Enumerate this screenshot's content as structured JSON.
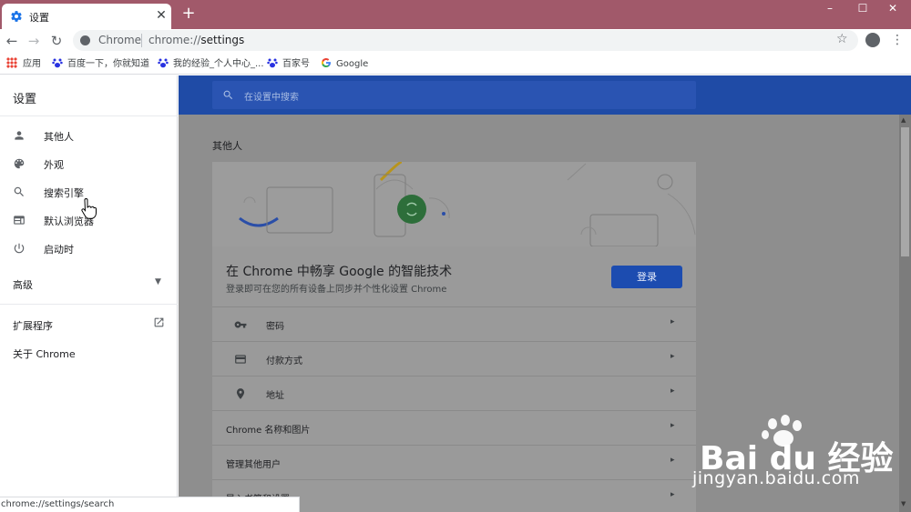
{
  "browser": {
    "tab_title": "设置",
    "tab_close": "✕",
    "new_tab": "+",
    "window_controls": [
      "–",
      "☐",
      "✕"
    ],
    "nav": {
      "back": "←",
      "forward": "→",
      "reload": "↻"
    },
    "omnibox": {
      "site_name": "Chrome",
      "url_scheme": "chrome://",
      "url_path": "settings"
    },
    "bookmarks": [
      {
        "label": "应用",
        "icon": "apps-grid-icon"
      },
      {
        "label": "百度一下，你就知道",
        "icon": "baidu-paw-icon"
      },
      {
        "label": "我的经验_个人中心_...",
        "icon": "baidu-paw-icon"
      },
      {
        "label": "百家号",
        "icon": "baidu-paw-icon"
      },
      {
        "label": "Google",
        "icon": "google-g-icon"
      }
    ],
    "status_text": "chrome://settings/search"
  },
  "sidebar": {
    "header": "设置",
    "items": [
      {
        "label": "其他人",
        "icon": "person-icon"
      },
      {
        "label": "外观",
        "icon": "palette-icon"
      },
      {
        "label": "搜索引擎",
        "icon": "search-icon"
      },
      {
        "label": "默认浏览器",
        "icon": "browser-window-icon"
      },
      {
        "label": "启动时",
        "icon": "power-icon"
      }
    ],
    "advanced": "高级",
    "extensions": "扩展程序",
    "about": "关于 Chrome"
  },
  "main": {
    "search_placeholder": "在设置中搜索",
    "section_title": "其他人",
    "signin_title": "在 Chrome 中畅享 Google 的智能技术",
    "signin_subtitle": "登录即可在您的所有设备上同步并个性化设置 Chrome",
    "login_button": "登录",
    "rows": [
      {
        "label": "密码",
        "icon": "key-icon",
        "indented": true
      },
      {
        "label": "付款方式",
        "icon": "credit-card-icon",
        "indented": true
      },
      {
        "label": "地址",
        "icon": "location-pin-icon",
        "indented": true
      },
      {
        "label": "Chrome 名称和图片",
        "icon": "",
        "indented": false
      },
      {
        "label": "管理其他用户",
        "icon": "",
        "indented": false
      },
      {
        "label": "导入书签和设置",
        "icon": "",
        "indented": false
      }
    ],
    "row_arrow": "▸"
  },
  "watermark": {
    "logo": "Bai du 经验",
    "url": "jingyan.baidu.com"
  },
  "colors": {
    "titlebar": "#a1596a",
    "settings_header": "#1f4ba6",
    "login_button": "#1c4cb0",
    "overlay_dim": "#8e8e8e"
  }
}
